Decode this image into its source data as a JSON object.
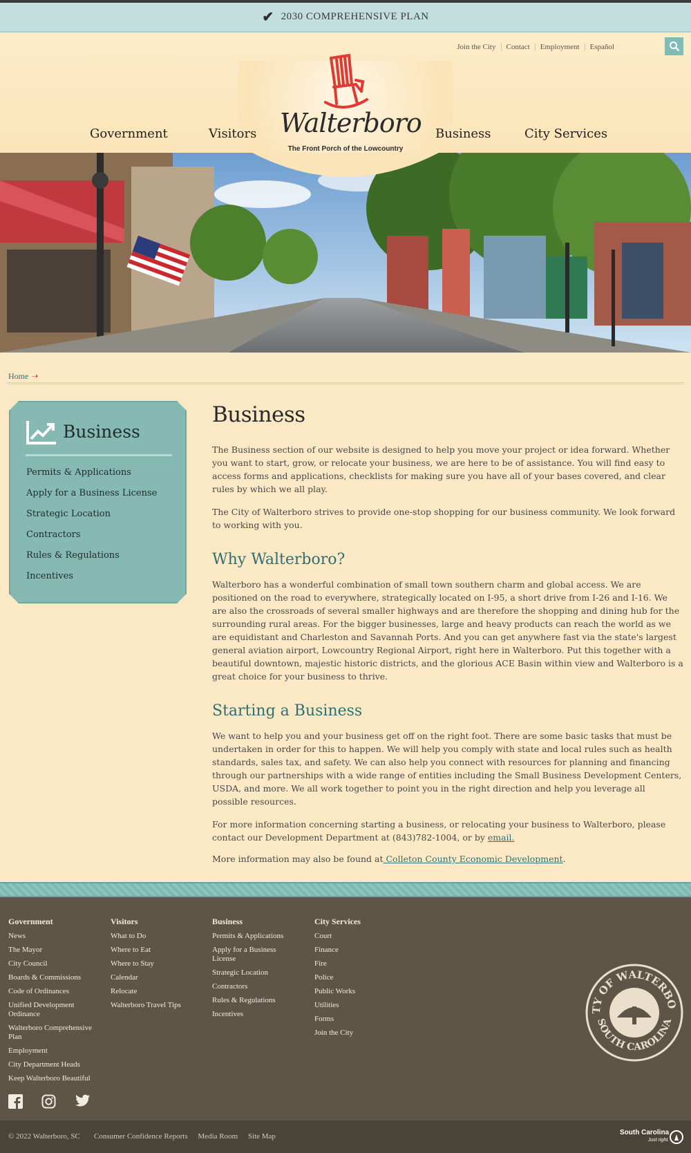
{
  "banner": {
    "text": "2030 COMPREHENSIVE PLAN"
  },
  "utility_nav": [
    "Join the City",
    "Contact",
    "Employment",
    "Español"
  ],
  "logo": {
    "name": "Walterboro",
    "tagline": "The Front Porch of the Lowcountry"
  },
  "main_nav": [
    "Government",
    "Visitors",
    "Business",
    "City Services"
  ],
  "breadcrumb": {
    "home": "Home"
  },
  "sidebar": {
    "title": "Business",
    "items": [
      "Permits & Applications",
      "Apply for a Business License",
      "Strategic Location",
      "Contractors",
      "Rules & Regulations",
      "Incentives"
    ]
  },
  "content": {
    "title": "Business",
    "intro_p1": "The Business section of our website is designed to help you move your project or idea forward. Whether you want to start, grow, or relocate your business, we are here to be of assistance.  You will find easy to access forms and applications, checklists for making sure you have all of your bases covered, and clear rules by which we all play.",
    "intro_p2": "The City of Walterboro strives to provide one-stop shopping for our business community.  We look forward to working with you.",
    "why_heading": "Why Walterboro?",
    "why_p": "Walterboro has a wonderful combination of small town southern charm and global access. We are positioned on the road to everywhere, strategically located on I-95, a short drive from I-26 and I-16.  We are also the crossroads of several smaller highways and are therefore the shopping and dining hub for the surrounding rural areas. For the bigger businesses, large and heavy products can reach the world as we are equidistant and Charleston and Savannah Ports.  And you can get anywhere fast via the state's largest general aviation airport, Lowcountry Regional Airport, right here in Walterboro.  Put this together with a beautiful downtown, majestic historic districts, and the glorious ACE Basin within view and Walterboro is a great choice for your business to thrive.",
    "start_heading": "Starting a Business",
    "start_p1": "We want to help you and your business get off on the right foot. There are some basic tasks that must be undertaken in order for this to happen. We will help you comply with state and local rules such as health standards, sales tax, and safety.  We can also help you connect with resources for planning and financing through our partnerships with a wide range of entities including the Small Business Development Centers, USDA, and more. We all work together to point you in the right direction and help you leverage all possible resources.",
    "start_p2_text": "For more information concerning starting a business, or relocating your business to Walterboro, please contact our Development Department at (843)782-1004, or by ",
    "start_p2_link": "email.",
    "more_text": "More information may also be found at",
    "more_link": " Colleton County Economic Development",
    "more_end": "."
  },
  "footer": {
    "government": {
      "title": "Government",
      "links": [
        "News",
        "The Mayor",
        "City Council",
        "Boards & Commissions",
        "Code of Ordinances",
        "Unified Development Ordinance",
        "Walterboro Comprehensive Plan",
        "Employment",
        "City Department Heads",
        "Keep Walterboro Beautiful"
      ]
    },
    "visitors": {
      "title": "Visitors",
      "links": [
        "What to Do",
        "Where to Eat",
        "Where to Stay",
        "Calendar",
        "Relocate",
        "Walterboro Travel Tips"
      ]
    },
    "business": {
      "title": "Business",
      "links": [
        "Permits & Applications",
        "Apply for a Business License",
        "Strategic Location",
        "Contractors",
        "Rules & Regulations",
        "Incentives"
      ]
    },
    "city_services": {
      "title": "City Services",
      "links": [
        "Court",
        "Finance",
        "Fire",
        "Police",
        "Public Works",
        "Utilities",
        "Forms",
        "Join the City"
      ]
    },
    "seal_text_top": "CITY OF WALTERBORO",
    "seal_text_bottom": "SOUTH CAROLINA"
  },
  "bottom": {
    "copyright": "© 2022 Walterboro, SC",
    "links": [
      "Consumer Confidence Reports",
      "Media Room",
      "Site Map"
    ],
    "sc_badge": "South Carolina",
    "sc_tagline": "Just right."
  },
  "colors": {
    "teal": "#86b9b2",
    "heading_teal": "#2e6f73",
    "cream": "#fbe9c6",
    "footer_brown": "#5e5546",
    "accent_red": "#d23a2c"
  }
}
